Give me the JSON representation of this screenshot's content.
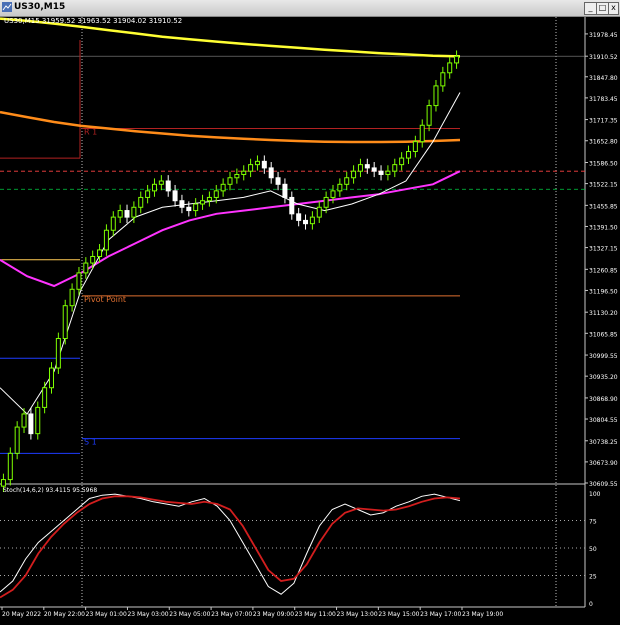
{
  "window": {
    "title": "US30,M15",
    "btn_min": "_",
    "btn_max": "□",
    "btn_close": "x"
  },
  "header": {
    "symbol_info": "US30,M15  31959.52 31963.52 31904.02 31910.52"
  },
  "colors": {
    "background": "#000000",
    "grid": "#5a5a5a",
    "axis_text": "#ffffff",
    "bull": "#7fff00",
    "bear": "#ffffff",
    "ema_slow": "#ffff33",
    "ema_mid": "#ff8c1a",
    "ma_pink": "#ff33ff",
    "ma_white": "#ffffff",
    "ma_peach": "#ffd4b0",
    "r1": "#b22222",
    "pivot": "#e07030",
    "s1": "#1e3cff",
    "stoch_main": "#ffffff",
    "stoch_signal": "#d21e1e"
  },
  "chart_data": [
    {
      "type": "candlestick",
      "title": "US30,M15",
      "ylim": [
        30609.55,
        32030
      ],
      "y_ticks": [
        "31978.45",
        "31910.52",
        "31847.80",
        "31783.45",
        "31717.35",
        "31652.80",
        "31586.50",
        "31522.15",
        "31455.85",
        "31391.50",
        "31327.15",
        "31260.85",
        "31196.50",
        "31130.20",
        "31065.85",
        "30999.55",
        "30935.20",
        "30868.90",
        "30804.55",
        "30738.25",
        "30673.90",
        "30609.55"
      ],
      "x_labels": [
        "20 May 2022",
        "20 May 22:00",
        "23 May 01:00",
        "23 May 03:00",
        "23 May 05:00",
        "23 May 07:00",
        "23 May 09:00",
        "23 May 11:00",
        "23 May 13:00",
        "23 May 15:00",
        "23 May 17:00",
        "23 May 19:00"
      ],
      "current_price": "31910.52",
      "levels": [
        {
          "name": "R1",
          "label": "R 1",
          "value": 31690
        },
        {
          "name": "Pivot Point",
          "label": "Pivot Point",
          "value": 31180
        },
        {
          "name": "S1",
          "label": "S 1",
          "value": 30745
        }
      ],
      "candles_close": [
        30620,
        30700,
        30780,
        30820,
        30760,
        30840,
        30900,
        30960,
        31050,
        31150,
        31200,
        31250,
        31280,
        31300,
        31320,
        31380,
        31420,
        31440,
        31420,
        31450,
        31480,
        31500,
        31520,
        31530,
        31500,
        31470,
        31450,
        31440,
        31460,
        31470,
        31480,
        31500,
        31520,
        31540,
        31550,
        31560,
        31580,
        31590,
        31570,
        31540,
        31520,
        31480,
        31430,
        31410,
        31400,
        31420,
        31450,
        31480,
        31500,
        31520,
        31540,
        31560,
        31580,
        31570,
        31560,
        31550,
        31560,
        31580,
        31600,
        31620,
        31650,
        31700,
        31760,
        31820,
        31860,
        31890,
        31910
      ],
      "series": [
        {
          "name": "slow MA",
          "values": [
            32025,
            32018,
            32010,
            32000,
            31990,
            31980,
            31970,
            31962,
            31955,
            31948,
            31942,
            31936,
            31930,
            31925,
            31920,
            31916,
            31912,
            31910
          ]
        },
        {
          "name": "mid MA",
          "values": [
            31740,
            31725,
            31710,
            31698,
            31690,
            31682,
            31675,
            31668,
            31663,
            31659,
            31655,
            31652,
            31650,
            31649,
            31649,
            31650,
            31652,
            31655
          ]
        },
        {
          "name": "pink MA",
          "values": [
            31290,
            31240,
            31210,
            31250,
            31300,
            31340,
            31380,
            31410,
            31430,
            31440,
            31450,
            31460,
            31470,
            31480,
            31490,
            31505,
            31520,
            31560
          ]
        },
        {
          "name": "white MA",
          "values": [
            30900,
            30820,
            30950,
            31200,
            31350,
            31420,
            31450,
            31460,
            31470,
            31480,
            31500,
            31460,
            31440,
            31460,
            31490,
            31530,
            31650,
            31800
          ]
        }
      ]
    },
    {
      "type": "line",
      "title": "Stoch(14,6,2) 93.4115 95.5968",
      "ylim": [
        0,
        100
      ],
      "y_ticks": [
        "100",
        "75",
        "50",
        "25",
        "0"
      ],
      "series": [
        {
          "name": "main",
          "values": [
            10,
            20,
            40,
            55,
            65,
            75,
            85,
            95,
            98,
            99,
            97,
            95,
            92,
            90,
            88,
            92,
            95,
            88,
            75,
            55,
            35,
            15,
            8,
            18,
            45,
            70,
            85,
            90,
            85,
            80,
            82,
            88,
            92,
            97,
            99,
            96,
            93
          ]
        },
        {
          "name": "signal",
          "values": [
            5,
            12,
            25,
            45,
            60,
            72,
            82,
            90,
            95,
            97,
            97,
            96,
            94,
            92,
            91,
            90,
            92,
            90,
            85,
            70,
            50,
            30,
            20,
            22,
            35,
            55,
            72,
            82,
            86,
            85,
            84,
            85,
            88,
            92,
            95,
            96,
            95
          ]
        }
      ]
    }
  ]
}
